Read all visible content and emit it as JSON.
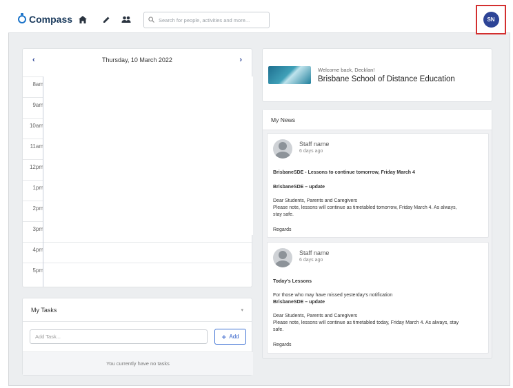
{
  "app": {
    "name": "Compass",
    "brand_color": "#1a73c9"
  },
  "nav": {
    "icons": [
      "home-icon",
      "pencil-icon",
      "people-icon"
    ],
    "search_placeholder": "Search for people, activities and more...",
    "user_initials": "SN",
    "avatar_color": "#2d4496"
  },
  "calendar": {
    "date": "Thursday, 10 March 2022",
    "prev": "‹",
    "next": "›",
    "hours": [
      "8am",
      "9am",
      "10am",
      "11am",
      "12pm",
      "1pm",
      "2pm",
      "3pm",
      "4pm",
      "5pm"
    ]
  },
  "tasks": {
    "title": "My Tasks",
    "input_placeholder": "Add Task...",
    "add_label": "Add",
    "empty_message": "You currently have no tasks"
  },
  "school": {
    "welcome": "Welcome back, Decklan!",
    "name": "Brisbane School of Distance Education"
  },
  "news": {
    "title": "My News",
    "items": [
      {
        "author": "Staff name",
        "time": "6 days ago",
        "headline": "BrisbaneSDE - Lessons to continue tomorrow, Friday March 4",
        "subhead": "BrisbaneSDE – update",
        "body_line1": "Dear Students, Parents and Caregivers",
        "body_line2": "Please note, lessons will continue as timetabled tomorrow, Friday March 4. As always,",
        "body_line3": "stay safe.",
        "signoff": "Regards"
      },
      {
        "author": "Staff name",
        "time": "6 days ago",
        "headline": "Today's Lessons",
        "intro": "For those who may have missed yesterday's notification",
        "subhead": "BrisbaneSDE – update",
        "body_line1": "Dear Students, Parents and Caregivers",
        "body_line2": "Please note, lessons will continue as timetabled today, Friday March 4. As always, stay",
        "body_line3": "safe.",
        "signoff": "Regards"
      }
    ]
  }
}
